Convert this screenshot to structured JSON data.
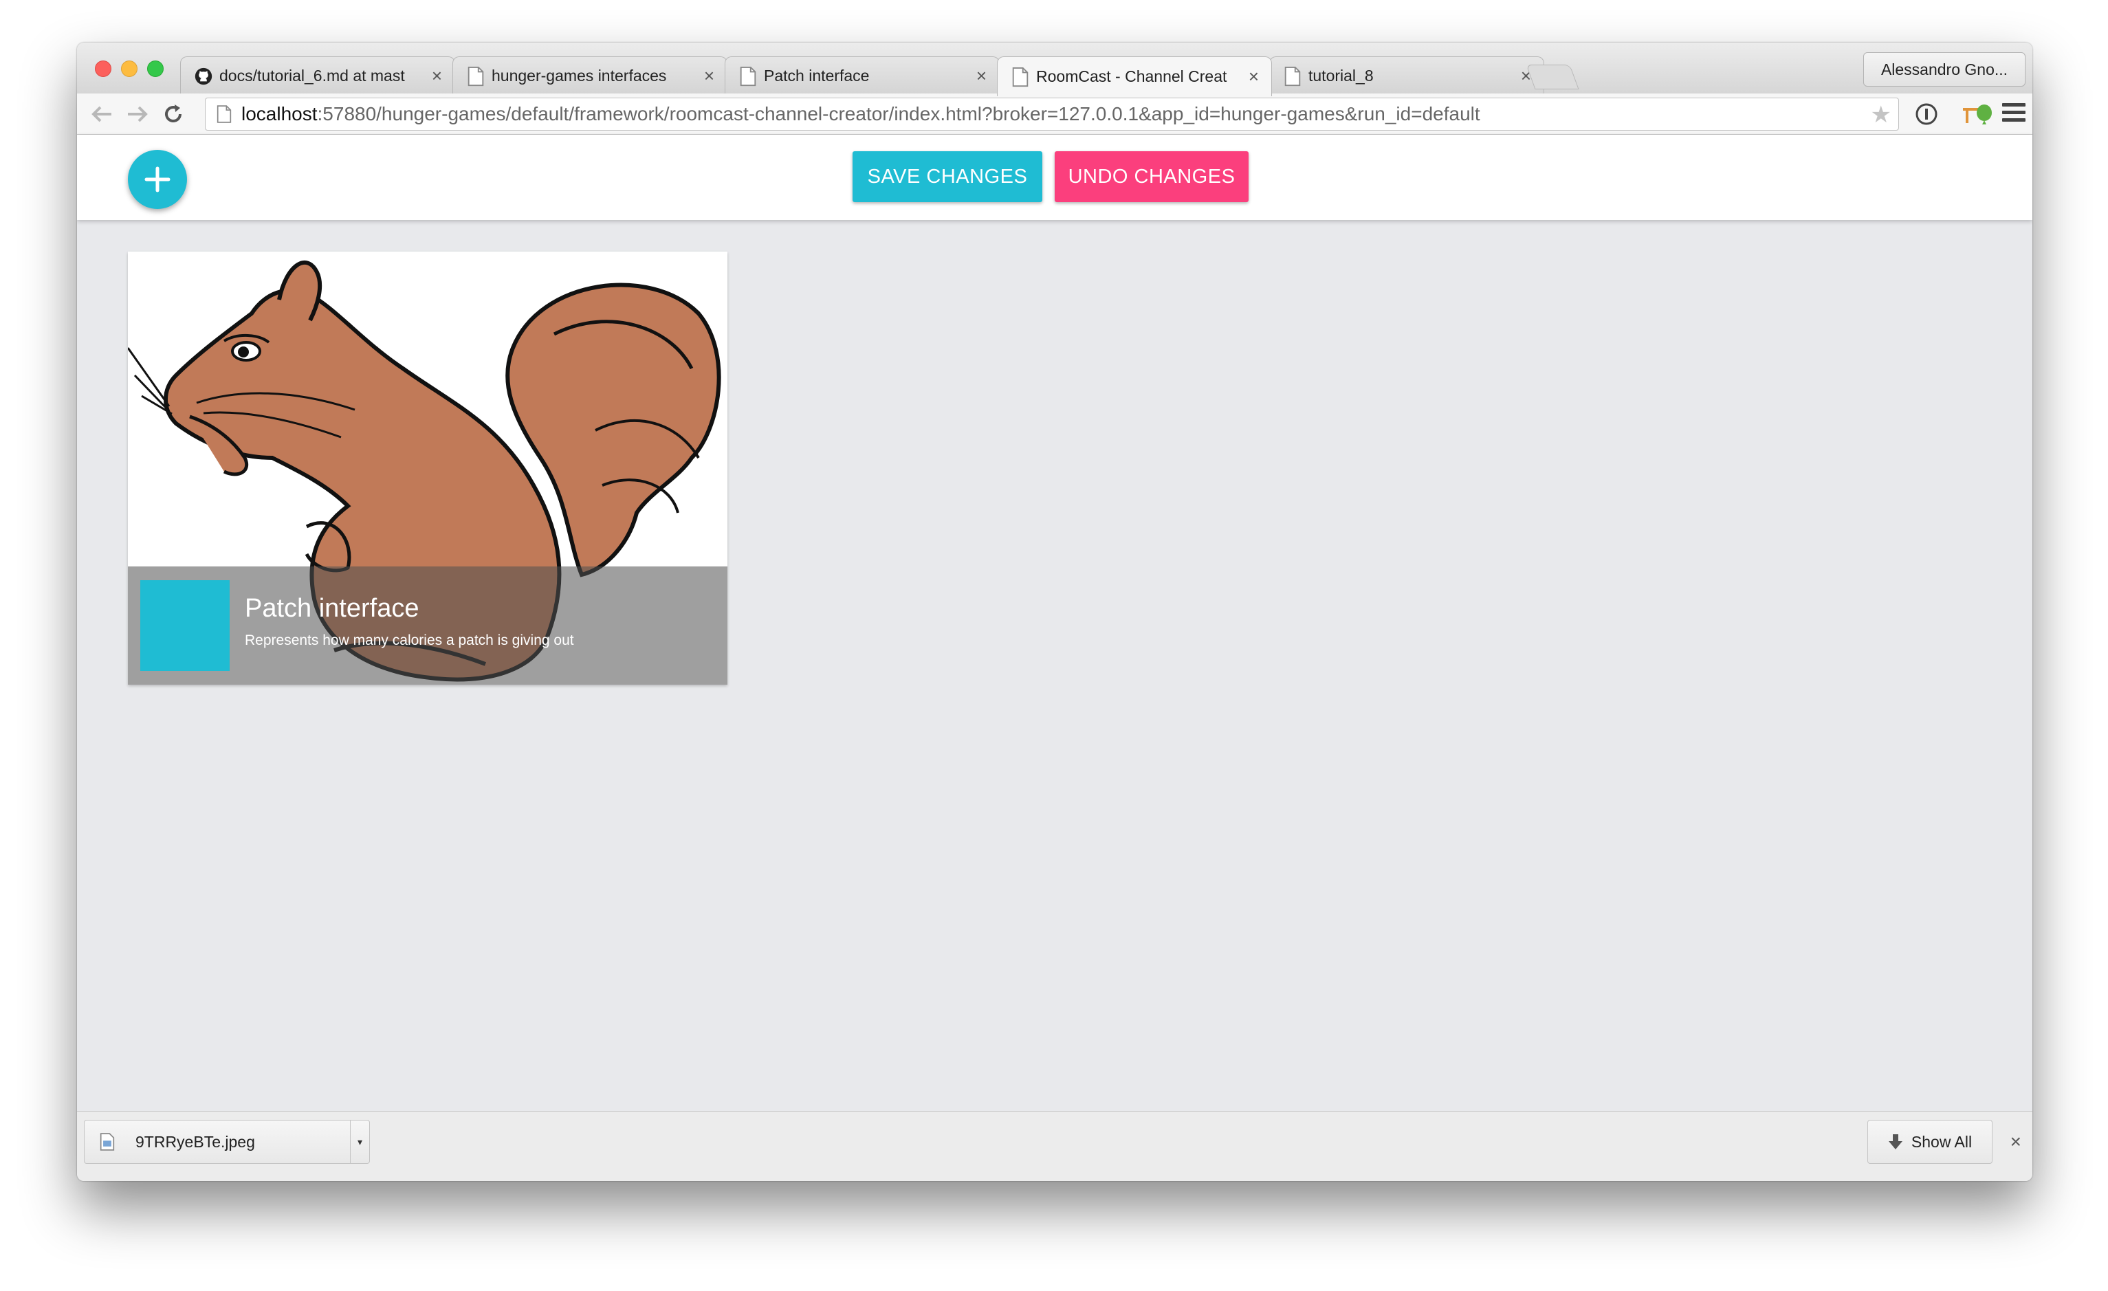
{
  "browser": {
    "tabs": [
      {
        "title": "docs/tutorial_6.md at mast",
        "icon": "github-icon"
      },
      {
        "title": "hunger-games interfaces",
        "icon": "page-icon"
      },
      {
        "title": "Patch interface",
        "icon": "page-icon"
      },
      {
        "title": "RoomCast - Channel Creat",
        "icon": "page-icon",
        "active": true
      },
      {
        "title": "tutorial_8",
        "icon": "page-icon"
      }
    ],
    "close_glyph": "×",
    "profile_name": "Alessandro Gno...",
    "url_host": "localhost",
    "url_rest": ":57880/hunger-games/default/framework/roomcast-channel-creator/index.html?broker=127.0.0.1&app_id=hunger-games&run_id=default"
  },
  "app": {
    "save_label": "SAVE CHANGES",
    "undo_label": "UNDO CHANGES",
    "colors": {
      "accent": "#1fbcd3",
      "undo": "#fb3f7d"
    }
  },
  "cards": [
    {
      "title": "Patch interface",
      "description": "Represents how many calories a patch is giving out",
      "swatch_color": "#1fbcd3",
      "image": "squirrel-illustration"
    }
  ],
  "downloads": {
    "file_name": "9TRRyeBTe.jpeg",
    "show_all_label": "Show All",
    "close_glyph": "×"
  }
}
